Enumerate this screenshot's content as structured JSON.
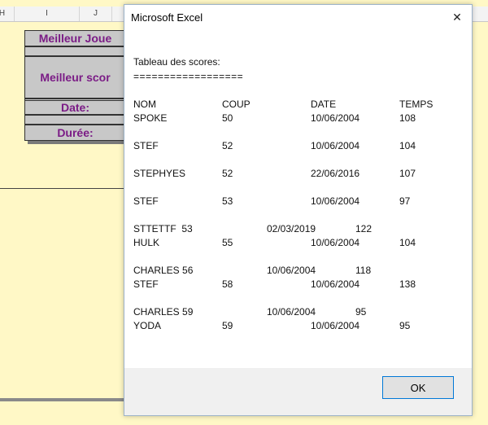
{
  "sheet": {
    "columns": [
      "H",
      "I",
      "J"
    ],
    "labels": {
      "best_player": "Meilleur Joue",
      "best_score": "Meilleur scor",
      "date": "Date:",
      "duration": "Durée:"
    }
  },
  "dialog": {
    "title": "Microsoft Excel",
    "close_glyph": "✕",
    "heading": "Tableau des scores:",
    "separator": "==================",
    "columns": [
      "NOM",
      "COUP",
      "DATE",
      "TEMPS"
    ],
    "rows": [
      {
        "nom": "SPOKE",
        "coup": "50",
        "date": "10/06/2004",
        "temps": "108"
      },
      {
        "nom": "STEF",
        "coup": "52",
        "date": "10/06/2004",
        "temps": "104"
      },
      {
        "nom": "STEPHYES",
        "coup": "52",
        "date": "22/06/2016",
        "temps": "107"
      },
      {
        "nom": "STEF",
        "coup": "53",
        "date": "10/06/2004",
        "temps": "97"
      },
      {
        "line": "STTETTF  53",
        "date": "02/03/2019",
        "temps": "122"
      },
      {
        "nom": "HULK",
        "coup": "55",
        "date": "10/06/2004",
        "temps": "104"
      },
      {
        "line": "CHARLES 56",
        "date": "10/06/2004",
        "temps": "118"
      },
      {
        "nom": "STEF",
        "coup": "58",
        "date": "10/06/2004",
        "temps": "138"
      },
      {
        "line": "CHARLES 59",
        "date": "10/06/2004",
        "temps": "95"
      },
      {
        "nom": "YODA",
        "coup": "59",
        "date": "10/06/2004",
        "temps": "95"
      }
    ],
    "ok_label": "OK"
  }
}
